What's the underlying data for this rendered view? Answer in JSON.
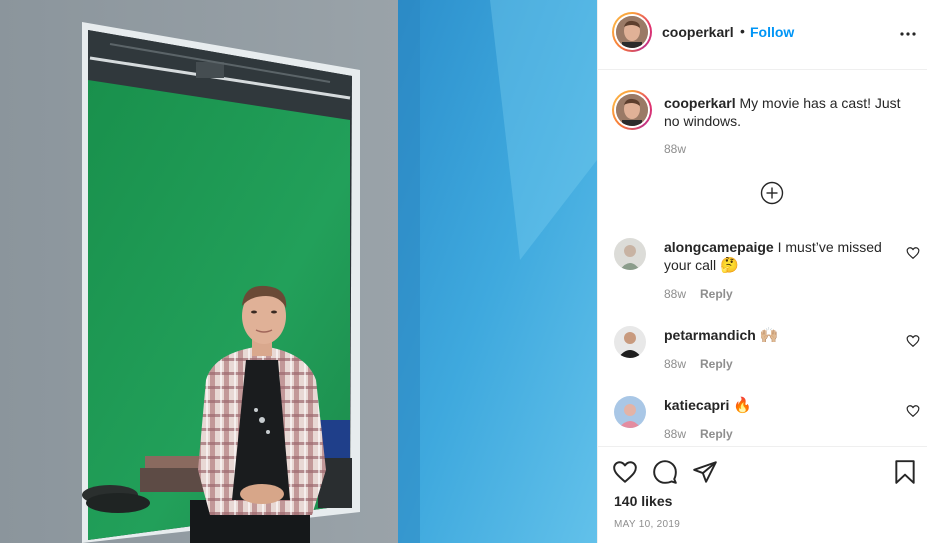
{
  "post": {
    "author": "cooperkarl",
    "follow_label": "Follow",
    "more_icon": "more-horizontal-icon",
    "caption_text": "My movie has a cast! Just no windows.",
    "caption_time": "88w",
    "load_more_icon": "plus-circle-icon"
  },
  "comments": [
    {
      "username": "alongcamepaige",
      "text": "I must’ve missed your call",
      "emoji": "🤔",
      "time": "88w",
      "reply_label": "Reply"
    },
    {
      "username": "petarmandich",
      "text": "",
      "emoji": "🙌🏼",
      "time": "88w",
      "reply_label": "Reply"
    },
    {
      "username": "katiecapri",
      "text": "",
      "emoji": "🔥",
      "time": "88w",
      "reply_label": "Reply"
    }
  ],
  "actions": {
    "icons": [
      "heart-icon",
      "comment-icon",
      "share-icon",
      "bookmark-icon"
    ],
    "likes": "140 likes",
    "date": "MAY 10, 2019"
  },
  "colors": {
    "accent": "#0095f6",
    "text": "#262626",
    "muted": "#8e8e8e",
    "border": "#efefef",
    "wall_blue": "#3fa9de",
    "green_screen": "#1f9c55",
    "wall_gray": "#8f9aa1"
  }
}
